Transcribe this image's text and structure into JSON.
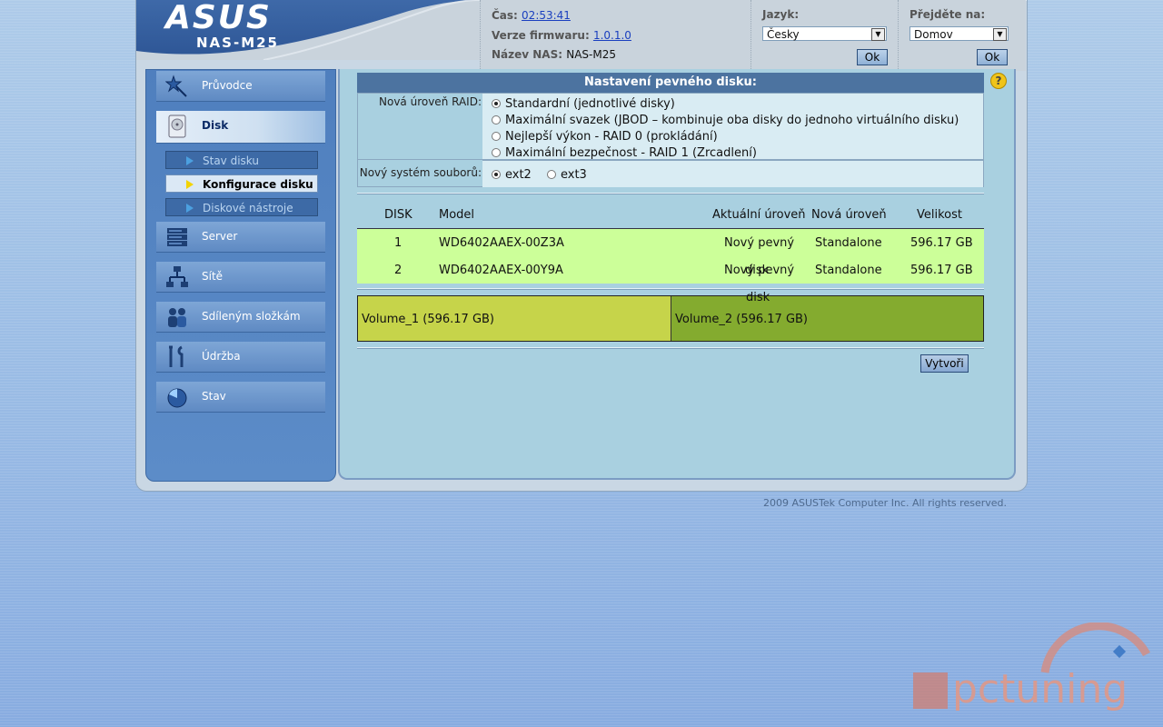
{
  "brand": {
    "logo": "ASUS",
    "model": "NAS-M25"
  },
  "header": {
    "time_label": "Čas:",
    "time_value": "02:53:41",
    "firmware_label": "Verze firmwaru:",
    "firmware_value": "1.0.1.0",
    "nas_name_label": "Název NAS:",
    "nas_name_value": "NAS-M25",
    "language_label": "Jazyk:",
    "language_value": "Česky",
    "language_ok": "Ok",
    "goto_label": "Přejděte na:",
    "goto_value": "Domov",
    "goto_ok": "Ok"
  },
  "sidebar": {
    "items": [
      {
        "label": "Průvodce",
        "icon": "wizard-wand-icon"
      },
      {
        "label": "Disk",
        "icon": "hard-disk-icon"
      },
      {
        "label": "Server",
        "icon": "server-icon"
      },
      {
        "label": "Sítě",
        "icon": "network-icon"
      },
      {
        "label": "Sdíleným složkám",
        "icon": "shared-users-icon"
      },
      {
        "label": "Údržba",
        "icon": "tools-icon"
      },
      {
        "label": "Stav",
        "icon": "status-pie-icon"
      }
    ],
    "disk_sub": [
      {
        "label": "Stav disku"
      },
      {
        "label": "Konfigurace disku"
      },
      {
        "label": "Diskové nástroje"
      }
    ]
  },
  "main": {
    "section_title": "Nastavení pevného disku:",
    "help": "?",
    "raid_label": "Nová úroveň RAID:",
    "raid_options": [
      "Standardní (jednotlivé disky)",
      "Maximální svazek (JBOD – kombinuje oba disky do jednoho virtuálního disku)",
      "Nejlepší výkon - RAID 0 (prokládání)",
      "Maximální bezpečnost - RAID 1 (Zrcadlení)"
    ],
    "raid_selected": 0,
    "fs_label": "Nový systém souborů:",
    "fs_options": [
      "ext2",
      "ext3"
    ],
    "fs_selected": 0,
    "table": {
      "headers": [
        "DISK",
        "Model",
        "Aktuální úroveň",
        "Nová úroveň",
        "Velikost"
      ],
      "rows": [
        {
          "disk": "1",
          "model": "WD6402AAEX-00Z3A",
          "current": "Nový pevný",
          "new": "Standalone",
          "size": "596.17 GB"
        },
        {
          "disk": "2",
          "model": "WD6402AAEX-00Y9A",
          "current": "Nový pevný",
          "new": "Standalone",
          "size": "596.17 GB"
        }
      ],
      "overflow_1": "disk",
      "overflow_2": "disk"
    },
    "volumes": [
      "Volume_1 (596.17 GB)",
      "Volume_2 (596.17 GB)"
    ],
    "volume_colors": [
      "#c6d44a",
      "#84ab2f"
    ],
    "create_button": "Vytvoři"
  },
  "footer": {
    "copyright": "2009 ASUSTek Computer Inc. All rights reserved."
  },
  "watermark": "pctuning"
}
